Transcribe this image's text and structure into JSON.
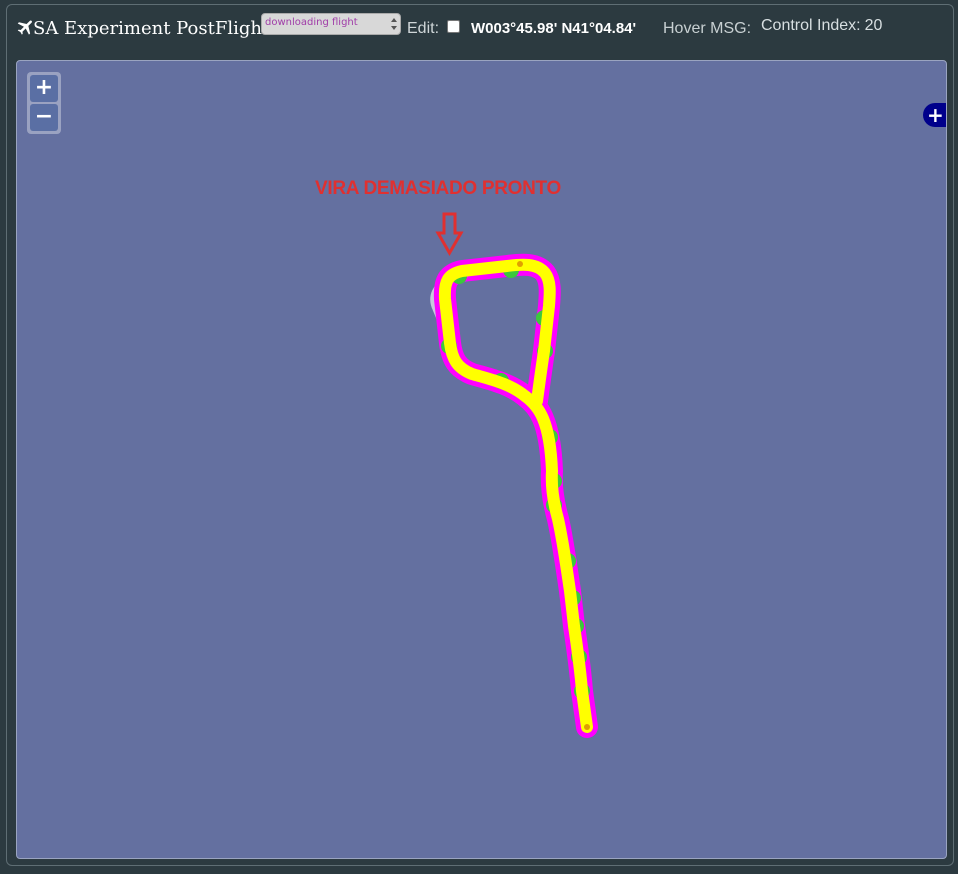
{
  "header": {
    "title": "SA Experiment PostFlight",
    "logo_icon": "airplane-icon",
    "flight_select_value": "downloading flight",
    "edit_label": "Edit:",
    "edit_checked": false,
    "coordinates": "W003°45.98' N41°04.84'",
    "hover_label": "Hover MSG:",
    "control_index_label": "Control Index:",
    "control_index_value": "20"
  },
  "map": {
    "zoom_in_label": "+",
    "zoom_out_label": "−",
    "layer_switcher_label": "+",
    "annotation_text": "VIRA DEMASIADO PRONTO",
    "annotation_color": "#e03030",
    "background_color": "#6470a0",
    "track_color": "#ffff00",
    "track_outline_color": "#ff00ff",
    "waypoint_color": "#3cc83c",
    "planned_path_color": "#c8c8dc"
  }
}
